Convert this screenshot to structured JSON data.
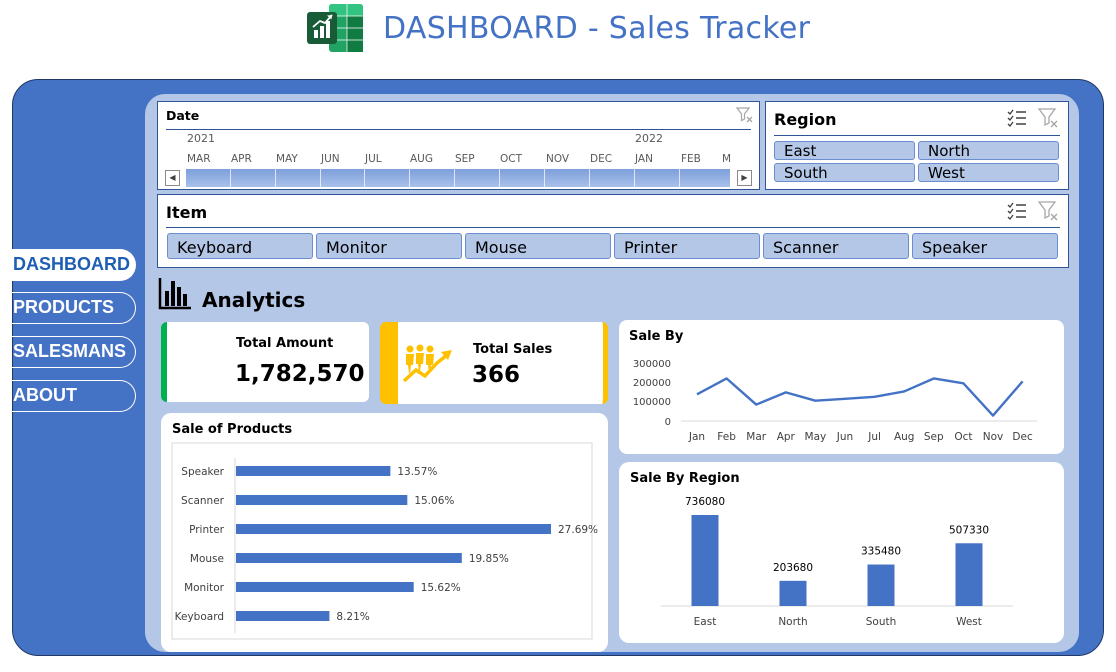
{
  "header": {
    "title": "DASHBOARD - Sales Tracker",
    "logo_icon": "excel-icon"
  },
  "nav": {
    "items": [
      {
        "label": "DASHBOARD",
        "active": true
      },
      {
        "label": "PRODUCTS",
        "active": false
      },
      {
        "label": "SALESMANS",
        "active": false
      },
      {
        "label": "ABOUT",
        "active": false
      }
    ]
  },
  "date_slicer": {
    "label": "Date",
    "years": [
      "2021",
      "2022"
    ],
    "months": [
      "MAR",
      "APR",
      "MAY",
      "JUN",
      "JUL",
      "AUG",
      "SEP",
      "OCT",
      "NOV",
      "DEC",
      "JAN",
      "FEB",
      "M"
    ],
    "left_arrow": "◀",
    "right_arrow": "▶"
  },
  "region_slicer": {
    "label": "Region",
    "items": [
      "East",
      "North",
      "South",
      "West"
    ]
  },
  "item_slicer": {
    "label": "Item",
    "items": [
      "Keyboard",
      "Monitor",
      "Mouse",
      "Printer",
      "Scanner",
      "Speaker"
    ]
  },
  "analytics": {
    "heading": "Analytics"
  },
  "kpis": {
    "total_amount": {
      "label": "Total Amount",
      "value": "1,782,570",
      "accent": "#00B050"
    },
    "total_sales": {
      "label": "Total Sales",
      "value": "366",
      "accent": "#FFC000"
    }
  },
  "colors": {
    "frame": "#4472C4",
    "panel": "#B4C7E7",
    "series": "#4472C4",
    "title": "#4472C4"
  },
  "charts": {
    "sale_by": {
      "title": "Sale By",
      "y_ticks": [
        "300000",
        "200000",
        "100000",
        "0"
      ]
    },
    "sale_of_products": {
      "title": "Sale of Products"
    },
    "sale_by_region": {
      "title": "Sale By Region"
    }
  },
  "chart_data": [
    {
      "type": "line",
      "title": "Sale By",
      "x": [
        "Jan",
        "Feb",
        "Mar",
        "Apr",
        "May",
        "Jun",
        "Jul",
        "Aug",
        "Sep",
        "Oct",
        "Nov",
        "Dec"
      ],
      "values": [
        138000,
        220000,
        85000,
        148000,
        105000,
        115000,
        125000,
        153000,
        220000,
        195000,
        28000,
        205000
      ],
      "ylim": [
        0,
        300000
      ],
      "grid": false
    },
    {
      "type": "bar",
      "title": "Sale of Products",
      "orientation": "horizontal",
      "categories": [
        "Speaker",
        "Scanner",
        "Printer",
        "Mouse",
        "Monitor",
        "Keyboard"
      ],
      "values": [
        13.57,
        15.06,
        27.69,
        19.85,
        15.62,
        8.21
      ],
      "labels": [
        "13.57%",
        "15.06%",
        "27.69%",
        "19.85%",
        "15.62%",
        "8.21%"
      ],
      "xlim": [
        0,
        27.69
      ]
    },
    {
      "type": "bar",
      "title": "Sale By Region",
      "categories": [
        "East",
        "North",
        "South",
        "West"
      ],
      "values": [
        736080,
        203680,
        335480,
        507330
      ],
      "labels": [
        "736080",
        "203680",
        "335480",
        "507330"
      ],
      "ylim": [
        0,
        736080
      ]
    }
  ]
}
